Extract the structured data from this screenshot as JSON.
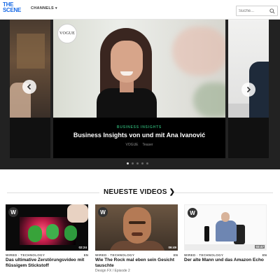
{
  "brand": {
    "logo_line1": "THE",
    "logo_line2": "SCENE",
    "accent": "#1a6be6"
  },
  "nav": {
    "channels_label": "CHANNELS",
    "channels_caret": "▾"
  },
  "search": {
    "placeholder": "Suche..."
  },
  "hero": {
    "eyebrow": "BUSINESS INSIGHTS",
    "title": "Business Insights von und mit Ana Ivanović",
    "channel": "VOGUE",
    "meta_right": "Teaser",
    "badge": "VOGUE",
    "eyebrow_color": "#2aa06a",
    "dots": 5,
    "active_dot": 0
  },
  "section": {
    "title": "NEUESTE VIDEOS",
    "arrow": "❯"
  },
  "videos": [
    {
      "badge": "W",
      "kicker": "WIRED · TECHNOLOGY",
      "lang": "EN",
      "title": "Das ultimative Zerstörungsvideo mit flüssigem Stickstoff",
      "subtitle": "",
      "duration": "02:24",
      "icon": "wired-logo-icon"
    },
    {
      "badge": "W",
      "kicker": "WIRED · TECHNOLOGY",
      "lang": "EN",
      "title": "Wie The Rock mal eben sein Gesicht tauschte",
      "subtitle": "Design FX / Episode 2",
      "duration": "06:49",
      "icon": "wired-logo-icon"
    },
    {
      "badge": "W",
      "kicker": "WIRED · TECHNOLOGY",
      "lang": "EN",
      "title": "Der alte Mann und das Amazon Echo",
      "subtitle": "",
      "duration": "03:47",
      "icon": "wired-logo-icon"
    }
  ]
}
